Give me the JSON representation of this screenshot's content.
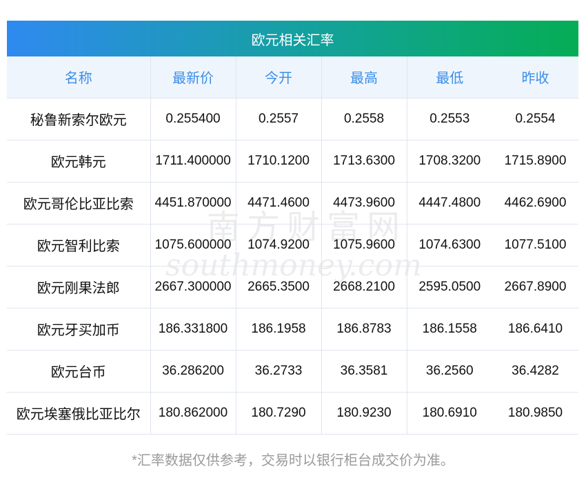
{
  "title": "欧元相关汇率",
  "columns": [
    "名称",
    "最新价",
    "今开",
    "最高",
    "最低",
    "昨收"
  ],
  "rows": [
    [
      "秘鲁新索尔欧元",
      "0.255400",
      "0.2557",
      "0.2558",
      "0.2553",
      "0.2554"
    ],
    [
      "欧元韩元",
      "1711.400000",
      "1710.1200",
      "1713.6300",
      "1708.3200",
      "1715.8900"
    ],
    [
      "欧元哥伦比亚比索",
      "4451.870000",
      "4471.4600",
      "4473.9600",
      "4447.4800",
      "4462.6900"
    ],
    [
      "欧元智利比索",
      "1075.600000",
      "1074.9200",
      "1075.9600",
      "1074.6300",
      "1077.5100"
    ],
    [
      "欧元刚果法郎",
      "2667.300000",
      "2665.3500",
      "2668.2100",
      "2595.0500",
      "2667.8900"
    ],
    [
      "欧元牙买加币",
      "186.331800",
      "186.1958",
      "186.8783",
      "186.1558",
      "186.6410"
    ],
    [
      "欧元台币",
      "36.286200",
      "36.2733",
      "36.3581",
      "36.2560",
      "36.4282"
    ],
    [
      "欧元埃塞俄比亚比尔",
      "180.862000",
      "180.7290",
      "180.9230",
      "180.6910",
      "180.9850"
    ]
  ],
  "footnote": "*汇率数据仅供参考，交易时以银行柜台成交价为准。",
  "watermark": {
    "cn": "南方财富网",
    "en": "southmoney.com"
  }
}
